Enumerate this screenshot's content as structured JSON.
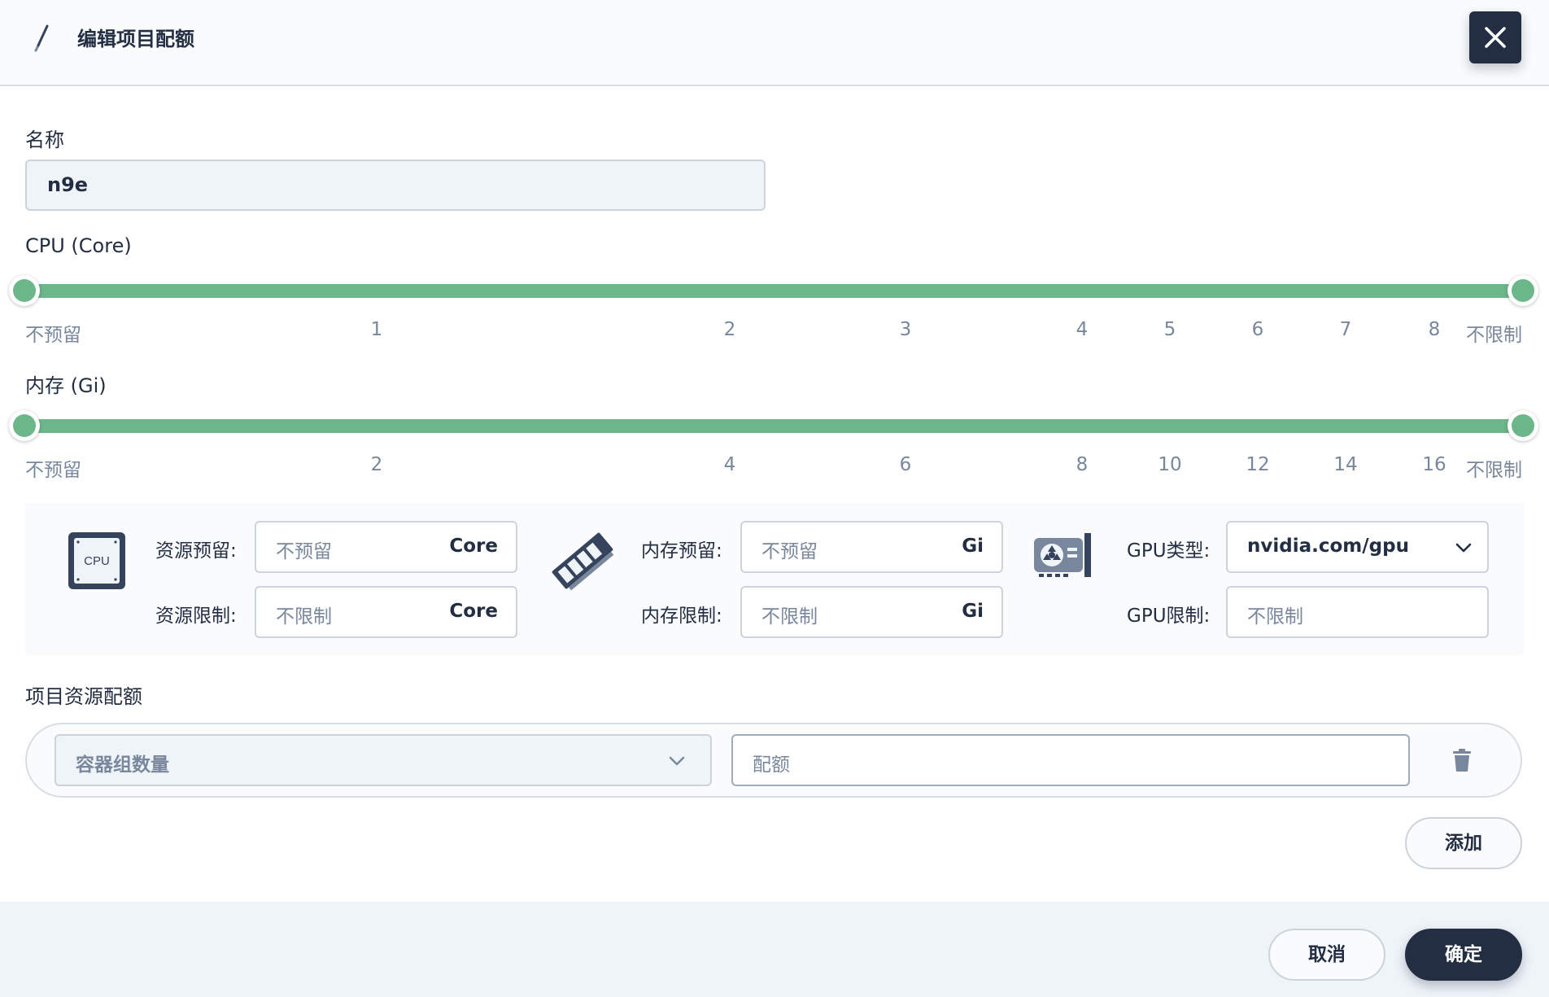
{
  "header": {
    "title": "编辑项目配额",
    "close_icon": "close-icon",
    "edit_icon": "pen-icon"
  },
  "name": {
    "label": "名称",
    "value": "n9e"
  },
  "cpu_slider": {
    "label": "CPU (Core)",
    "ticks": [
      "不预留",
      "1",
      "2",
      "3",
      "4",
      "5",
      "6",
      "7",
      "8",
      "不限制"
    ],
    "range": [
      "不预留",
      "不限制"
    ]
  },
  "memory_slider": {
    "label": "内存 (Gi)",
    "ticks": [
      "不预留",
      "2",
      "4",
      "6",
      "8",
      "10",
      "12",
      "14",
      "16",
      "不限制"
    ],
    "range": [
      "不预留",
      "不限制"
    ]
  },
  "resources": {
    "cpu": {
      "icon": "cpu-chip-icon",
      "icon_text": "CPU",
      "reserve_label": "资源预留:",
      "reserve_placeholder": "不预留",
      "limit_label": "资源限制:",
      "limit_placeholder": "不限制",
      "unit": "Core"
    },
    "memory": {
      "icon": "memory-stick-icon",
      "reserve_label": "内存预留:",
      "reserve_placeholder": "不预留",
      "limit_label": "内存限制:",
      "limit_placeholder": "不限制",
      "unit": "Gi"
    },
    "gpu": {
      "icon": "gpu-card-icon",
      "type_label": "GPU类型:",
      "type_value": "nvidia.com/gpu",
      "limit_label": "GPU限制:",
      "limit_placeholder": "不限制"
    }
  },
  "quota": {
    "label": "项目资源配额",
    "select_placeholder": "容器组数量",
    "input_placeholder": "配额",
    "add_label": "添加"
  },
  "footer": {
    "cancel_label": "取消",
    "confirm_label": "确定"
  },
  "colors": {
    "accent": "#6cb78a",
    "dark": "#242e42",
    "muted": "#79879c",
    "border": "#ccd3db"
  }
}
